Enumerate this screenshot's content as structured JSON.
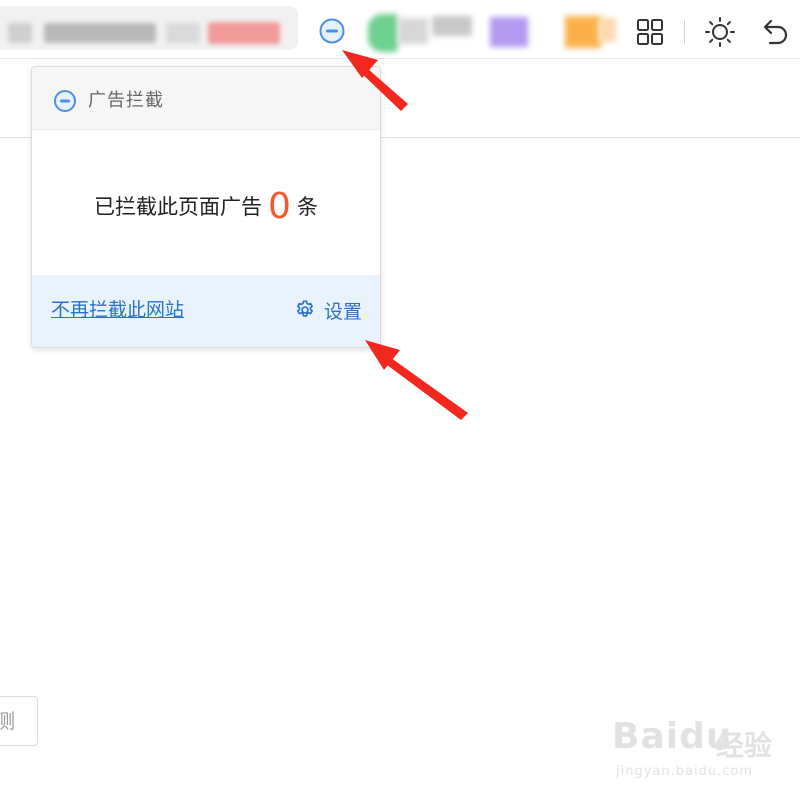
{
  "toolbar": {
    "icons": [
      "adblock-icon",
      "apps-grid-icon",
      "sun-icon",
      "undo-icon"
    ]
  },
  "popup": {
    "title": "广告拦截",
    "stat_prefix": "已拦截此页面广告",
    "stat_count": "0",
    "stat_suffix": "条",
    "unblock_label": "不再拦截此网站",
    "settings_label": "设置"
  },
  "partial_box": {
    "text": "测"
  },
  "watermark": {
    "logo": "Baidu",
    "sub": "经验",
    "url": "jingyan.baidu.com"
  },
  "colors": {
    "accent_blue": "#2b72c7",
    "count_orange": "#f25a2a",
    "footer_bg": "#e8f3fd",
    "arrow_red": "#f2281e",
    "icon_blue": "#4a90e2"
  }
}
